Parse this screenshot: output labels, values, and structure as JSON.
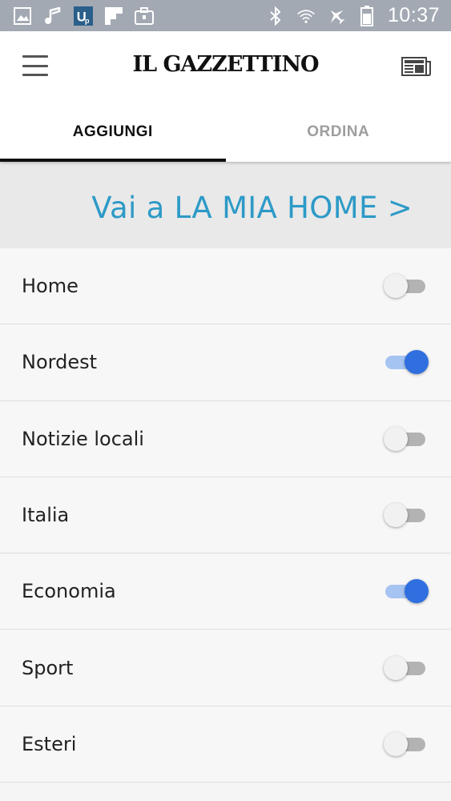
{
  "status_bar": {
    "time": "10:37",
    "left_icons": [
      "gallery-icon",
      "music-icon",
      "app-badge-icon",
      "flipboard-icon",
      "briefcase-icon"
    ],
    "right_icons": [
      "bluetooth-icon",
      "wifi-icon",
      "airplane-icon",
      "battery-icon"
    ]
  },
  "app_bar": {
    "title": "IL GAZZETTINO"
  },
  "tabs": [
    {
      "label": "AGGIUNGI",
      "active": true
    },
    {
      "label": "ORDINA",
      "active": false
    }
  ],
  "banner": {
    "link_text": "Vai a LA MIA HOME >"
  },
  "sections": [
    {
      "label": "Home",
      "enabled": false
    },
    {
      "label": "Nordest",
      "enabled": true
    },
    {
      "label": "Notizie locali",
      "enabled": false
    },
    {
      "label": "Italia",
      "enabled": false
    },
    {
      "label": "Economia",
      "enabled": true
    },
    {
      "label": "Sport",
      "enabled": false
    },
    {
      "label": "Esteri",
      "enabled": false
    }
  ],
  "colors": {
    "accent_link": "#2d9ac7",
    "toggle_on": "#2f6fe0",
    "status_bar": "#a3a9b3"
  }
}
